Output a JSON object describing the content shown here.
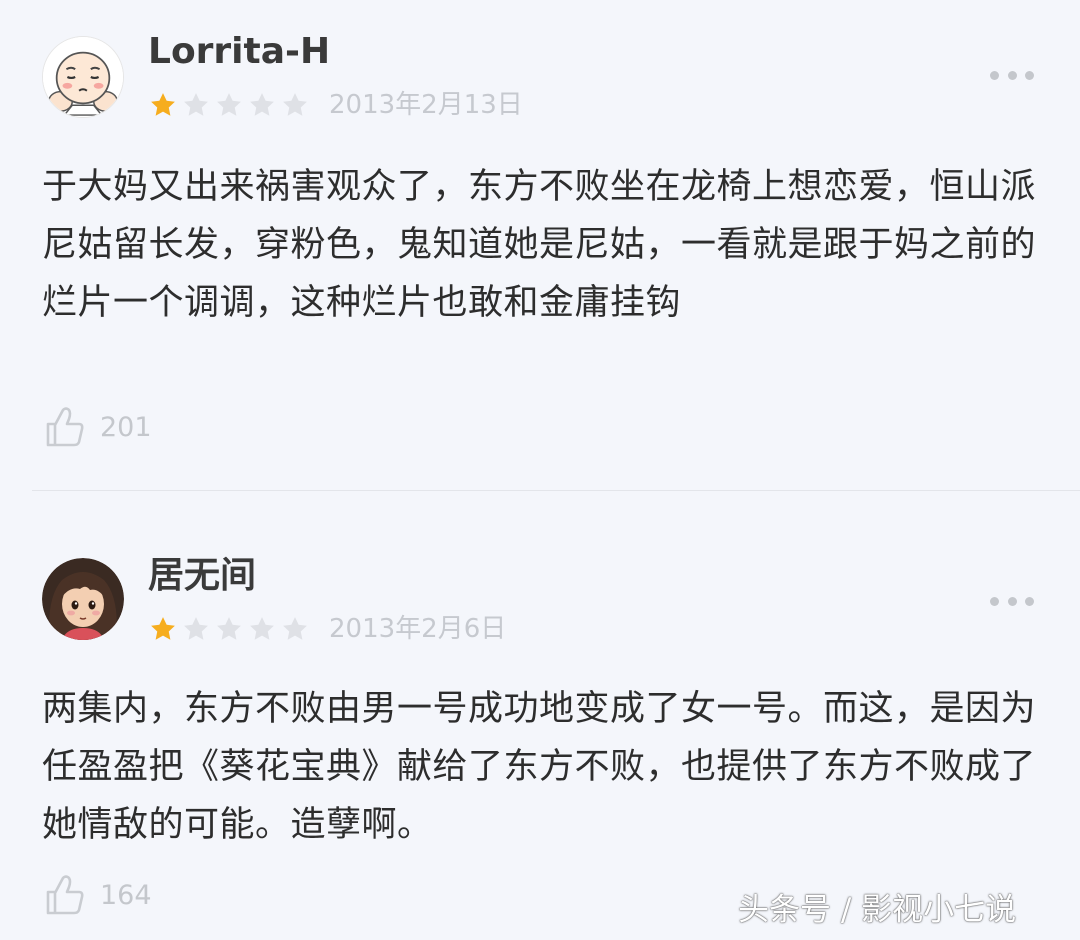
{
  "reviews": [
    {
      "username": "Lorrita-H",
      "rating": 1,
      "max_rating": 5,
      "date": "2013年2月13日",
      "text": "于大妈又出来祸害观众了，东方不败坐在龙椅上想恋爱，恒山派尼姑留长发，穿粉色，鬼知道她是尼姑，一看就是跟于妈之前的烂片一个调调，这种烂片也敢和金庸挂钩",
      "likes": "201",
      "avatar_icon": "cartoon-face-avatar"
    },
    {
      "username": "居无间",
      "rating": 1,
      "max_rating": 5,
      "date": "2013年2月6日",
      "text": "两集内，东方不败由男一号成功地变成了女一号。而这，是因为任盈盈把《葵花宝典》献给了东方不败，也提供了东方不败成了她情敌的可能。造孽啊。",
      "likes": "164",
      "avatar_icon": "anime-girl-avatar"
    }
  ],
  "icons": {
    "star_filled": "star-filled-icon",
    "star_empty": "star-empty-icon",
    "more": "more-dots-icon",
    "like": "thumbs-up-icon"
  },
  "colors": {
    "background": "#f4f6fb",
    "star_filled": "#f6ad1e",
    "star_empty": "#dfe1e6",
    "muted_text": "#c4c7cc"
  },
  "watermark": "头条号 / 影视小七说"
}
